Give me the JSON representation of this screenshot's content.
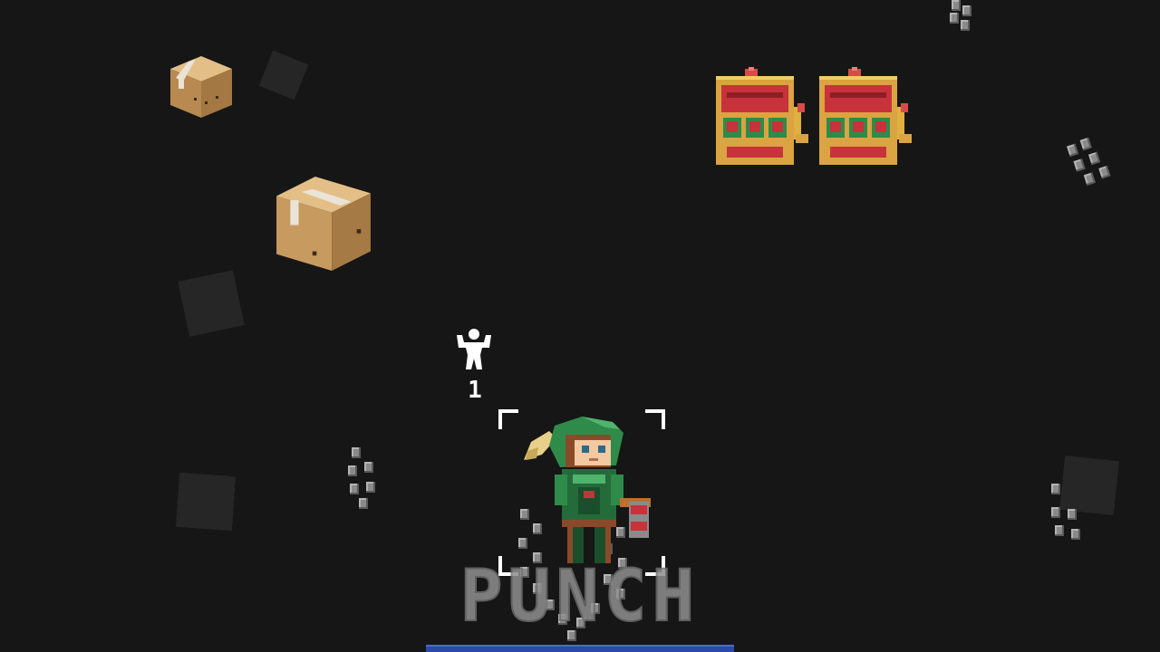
{
  "hud": {
    "power_icon": "flexing-strongman-icon",
    "power_count": "1",
    "action_label": "PUNCH"
  },
  "objects": {
    "box_icon": "cardboard-box-icon",
    "slot_icon": "slot-machine-icon",
    "rubble_icon": "stone-rubble-icon"
  },
  "colors": {
    "background": "#161616",
    "box": "#c9a06a",
    "slot_frame": "#d9a441",
    "slot_red": "#c8323a",
    "player_green": "#2e8b4a",
    "action_bar": "#2c48a8"
  }
}
